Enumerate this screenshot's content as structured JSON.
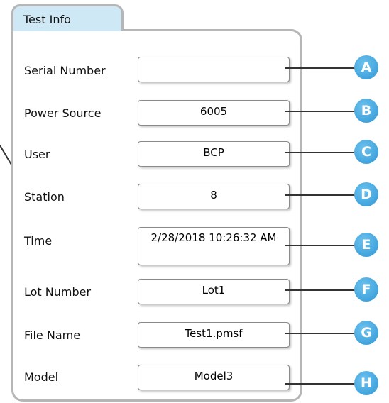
{
  "panel": {
    "title": "Test Info"
  },
  "rows": [
    {
      "label": "Serial Number",
      "value": "",
      "callout": "A"
    },
    {
      "label": "Power Source",
      "value": "6005",
      "callout": "B"
    },
    {
      "label": "User",
      "value": "BCP",
      "callout": "C"
    },
    {
      "label": "Station",
      "value": "8",
      "callout": "D"
    },
    {
      "label": "Time",
      "value": "2/28/2018 10:26:32 AM",
      "callout": "E"
    },
    {
      "label": "Lot Number",
      "value": "Lot1",
      "callout": "F"
    },
    {
      "label": "File Name",
      "value": "Test1.pmsf",
      "callout": "G"
    },
    {
      "label": "Model",
      "value": "Model3",
      "callout": "H"
    }
  ],
  "colors": {
    "callout_blue": "#3aa6e0",
    "tab_bg": "#cfe8f6",
    "border": "#b6b6b6"
  }
}
